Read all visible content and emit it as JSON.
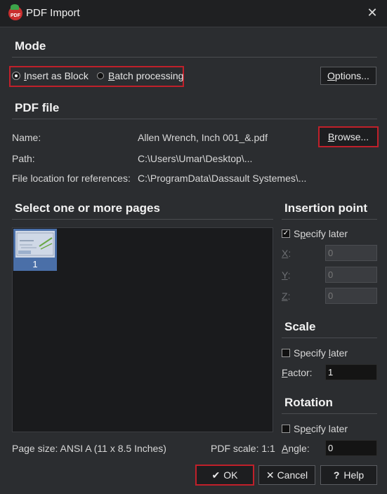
{
  "window": {
    "title": "PDF Import",
    "app_icon_text": "PDF"
  },
  "mode": {
    "heading": "Mode",
    "insert_as_block_u": "I",
    "insert_as_block_rest": "nsert as Block",
    "batch_processing_u": "B",
    "batch_processing_rest": "atch processing",
    "selected": "Insert as Block",
    "options_u": "O",
    "options_rest": "ptions..."
  },
  "pdf_file": {
    "heading": "PDF file",
    "name_label": "Name:",
    "name_value": "Allen Wrench, Inch 001_&.pdf",
    "browse_u": "B",
    "browse_rest": "rowse...",
    "path_label": "Path:",
    "path_value": "C:\\Users\\Umar\\Desktop\\...",
    "location_label": "File location for references:",
    "location_value": "C:\\ProgramData\\Dassault Systemes\\..."
  },
  "pages": {
    "heading": "Select one or more pages",
    "thumb_number": "1",
    "page_size": "Page size: ANSI A (11 x 8.5 Inches)",
    "pdf_scale": "PDF scale: 1:1"
  },
  "insertion_point": {
    "heading": "Insertion point",
    "specify_later_pre": "S",
    "specify_later_u": "p",
    "specify_later_rest": "ecify later",
    "specify_later_checked": true,
    "x_label_u": "X",
    "x_label_rest": ":",
    "x_value": "0",
    "y_label_u": "Y",
    "y_label_rest": ":",
    "y_value": "0",
    "z_label_u": "Z",
    "z_label_rest": ":",
    "z_value": "0"
  },
  "scale": {
    "heading": "Scale",
    "specify_later_pre": "Specify ",
    "specify_later_u": "l",
    "specify_later_rest": "ater",
    "specify_later_checked": false,
    "factor_label_u": "F",
    "factor_label_rest": "actor:",
    "factor_value": "1"
  },
  "rotation": {
    "heading": "Rotation",
    "specify_later_pre": "Sp",
    "specify_later_u": "e",
    "specify_later_rest": "cify later",
    "specify_later_checked": false,
    "angle_label_u": "A",
    "angle_label_rest": "ngle:",
    "angle_value": "0"
  },
  "footer": {
    "ok_glyph": "✔",
    "ok_label": "OK",
    "cancel_glyph": "✕",
    "cancel_label": "Cancel",
    "help_glyph": "?",
    "help_label": "Help"
  },
  "colors": {
    "highlight_border": "#c0202a",
    "background": "#2b2d30",
    "thumb_selected": "#4a6fa8"
  }
}
